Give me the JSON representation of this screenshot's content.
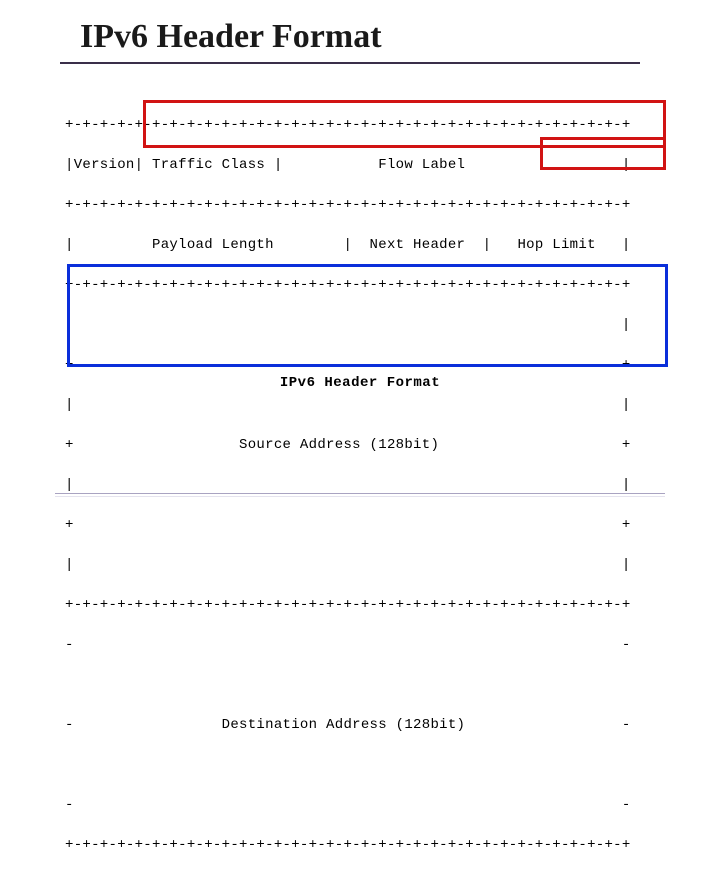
{
  "title": "IPv6 Header Format",
  "ascii": {
    "l0": "+-+-+-+-+-+-+-+-+-+-+-+-+-+-+-+-+-+-+-+-+-+-+-+-+-+-+-+-+-+-+-+-+",
    "l1": "|Version| Traffic Class |           Flow Label                  |",
    "l2": "+-+-+-+-+-+-+-+-+-+-+-+-+-+-+-+-+-+-+-+-+-+-+-+-+-+-+-+-+-+-+-+-+",
    "l3": "|         Payload Length        |  Next Header  |   Hop Limit   |",
    "l4": "+-+-+-+-+-+-+-+-+-+-+-+-+-+-+-+-+-+-+-+-+-+-+-+-+-+-+-+-+-+-+-+-+",
    "l5": "|                                                               |",
    "l6": "+                                                               +",
    "l7": "|                                                               |",
    "l8": "+                   Source Address (128bit)                     +",
    "l9": "|                                                               |",
    "l10": "+                                                               +",
    "l11": "|                                                               |",
    "l12": "+-+-+-+-+-+-+-+-+-+-+-+-+-+-+-+-+-+-+-+-+-+-+-+-+-+-+-+-+-+-+-+-+",
    "l13": "-                                                               -",
    "l14": "                                                                 ",
    "l15": "-                 Destination Address (128bit)                  -",
    "l16": "                                                                 ",
    "l17": "-                                                               -",
    "l18": "+-+-+-+-+-+-+-+-+-+-+-+-+-+-+-+-+-+-+-+-+-+-+-+-+-+-+-+-+-+-+-+-+"
  },
  "caption": "IPv6 Header Format",
  "header_fields": {
    "version": "Version",
    "traffic_class": "Traffic Class",
    "flow_label": "Flow Label",
    "payload_length": "Payload Length",
    "next_header": "Next Header",
    "hop_limit": "Hop Limit",
    "source_address": "Source Address (128bit)",
    "destination_address": "Destination Address (128bit)"
  },
  "highlights": {
    "red_box_top": "Traffic Class + Flow Label",
    "red_box_small": "Hop Limit",
    "blue_box": "Destination Address (128bit)"
  }
}
